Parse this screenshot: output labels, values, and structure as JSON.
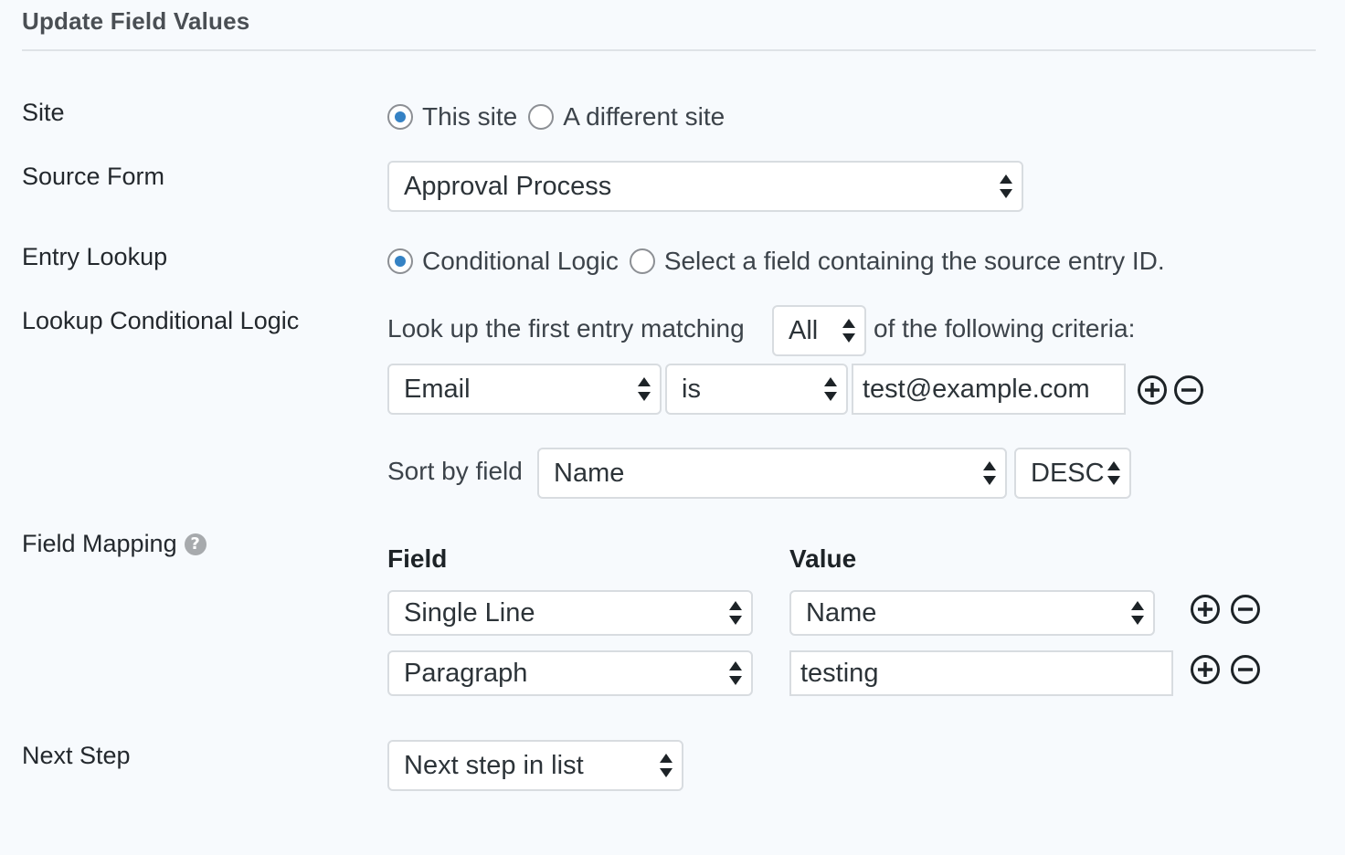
{
  "section": {
    "title": "Update Field Values"
  },
  "site": {
    "label": "Site",
    "options": [
      {
        "label": "This site",
        "selected": true
      },
      {
        "label": "A different site",
        "selected": false
      }
    ]
  },
  "source_form": {
    "label": "Source Form",
    "selected": "Approval Process"
  },
  "entry_lookup": {
    "label": "Entry Lookup",
    "options": [
      {
        "label": "Conditional Logic",
        "selected": true
      },
      {
        "label": "Select a field containing the source entry ID.",
        "selected": false
      }
    ]
  },
  "lookup_logic": {
    "label": "Lookup Conditional Logic",
    "prefix_text": "Look up the first entry matching",
    "match_type": "All",
    "suffix_text": "of the following criteria:",
    "rule": {
      "field": "Email",
      "operator": "is",
      "value": "test@example.com"
    },
    "sort_label": "Sort by field",
    "sort_field": "Name",
    "sort_direction": "DESC"
  },
  "field_mapping": {
    "label": "Field Mapping",
    "help_icon": "?",
    "col_field": "Field",
    "col_value": "Value",
    "rows": [
      {
        "field": "Single Line",
        "value": "Name",
        "value_type": "select"
      },
      {
        "field": "Paragraph",
        "value": "testing",
        "value_type": "text"
      }
    ]
  },
  "next_step": {
    "label": "Next Step",
    "selected": "Next step in list"
  },
  "colors": {
    "background": "#f7fafd",
    "radio_selected": "#3582c4",
    "border": "#d8dce0"
  },
  "icons": {
    "add": "plus-circle-icon",
    "remove": "minus-circle-icon",
    "help": "help-icon"
  }
}
